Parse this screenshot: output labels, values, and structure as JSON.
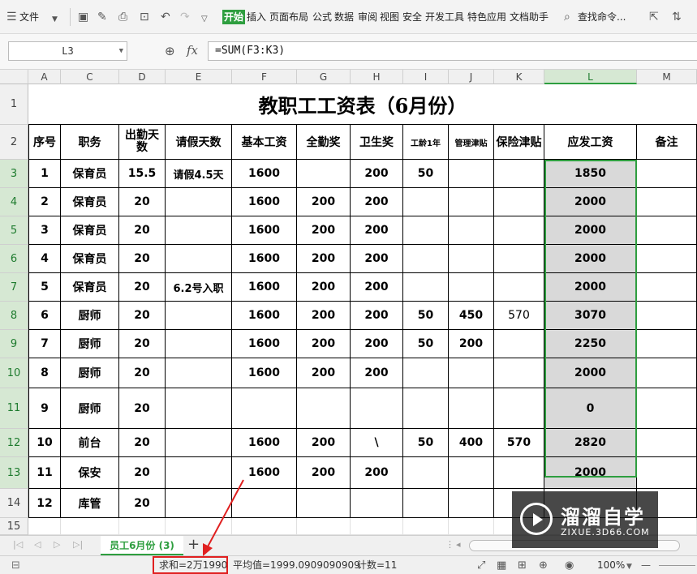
{
  "menubar": {
    "file_label": "文件",
    "tabs": [
      "开始",
      "插入",
      "页面布局",
      "公式",
      "数据",
      "审阅",
      "视图",
      "安全",
      "开发工具",
      "特色应用",
      "文档助手"
    ],
    "active_tab": "开始",
    "search_label": "查找命令..."
  },
  "formula": {
    "cell_ref": "L3",
    "fx_label": "fx",
    "formula_text": "=SUM(F3:K3)"
  },
  "columns": [
    "A",
    "C",
    "D",
    "E",
    "F",
    "G",
    "H",
    "I",
    "J",
    "K",
    "L",
    "M"
  ],
  "rows": [
    "1",
    "2",
    "3",
    "4",
    "5",
    "6",
    "7",
    "8",
    "9",
    "10",
    "11",
    "12",
    "13",
    "14",
    "15"
  ],
  "title": "教职工工资表（6月份）",
  "headers": [
    "序号",
    "职务",
    "出勤天数",
    "请假天数",
    "基本工资",
    "全勤奖",
    "卫生奖",
    "工龄1年",
    "管理津贴",
    "保险津贴",
    "应发工资",
    "备注"
  ],
  "table": [
    [
      "1",
      "保育员",
      "15.5",
      "请假4.5天",
      "1600",
      "",
      "200",
      "50",
      "",
      "",
      "1850",
      ""
    ],
    [
      "2",
      "保育员",
      "20",
      "",
      "1600",
      "200",
      "200",
      "",
      "",
      "",
      "2000",
      ""
    ],
    [
      "3",
      "保育员",
      "20",
      "",
      "1600",
      "200",
      "200",
      "",
      "",
      "",
      "2000",
      ""
    ],
    [
      "4",
      "保育员",
      "20",
      "",
      "1600",
      "200",
      "200",
      "",
      "",
      "",
      "2000",
      ""
    ],
    [
      "5",
      "保育员",
      "20",
      "6.2号入职",
      "1600",
      "200",
      "200",
      "",
      "",
      "",
      "2000",
      ""
    ],
    [
      "6",
      "厨师",
      "20",
      "",
      "1600",
      "200",
      "200",
      "50",
      "450",
      "570",
      "3070",
      ""
    ],
    [
      "7",
      "厨师",
      "20",
      "",
      "1600",
      "200",
      "200",
      "50",
      "200",
      "",
      "2250",
      ""
    ],
    [
      "8",
      "厨师",
      "20",
      "",
      "1600",
      "200",
      "200",
      "",
      "",
      "",
      "2000",
      ""
    ],
    [
      "9",
      "厨师",
      "20",
      "",
      "",
      "",
      "",
      "",
      "",
      "",
      "0",
      ""
    ],
    [
      "10",
      "前台",
      "20",
      "",
      "1600",
      "200",
      "\\",
      "50",
      "400",
      "570",
      "2820",
      ""
    ],
    [
      "11",
      "保安",
      "20",
      "",
      "1600",
      "200",
      "200",
      "",
      "",
      "",
      "2000",
      ""
    ],
    [
      "12",
      "库管",
      "20",
      "",
      "",
      "",
      "",
      "",
      "",
      "",
      "",
      ""
    ]
  ],
  "sheet_tab": "员工6月份 (3)",
  "status": {
    "sum": "求和=2万1990",
    "avg": "平均值=1999.0909090909",
    "count": "计数=11",
    "zoom": "100%"
  },
  "watermark": {
    "name": "溜溜自学",
    "url": "ZIXUE.3D66.COM"
  },
  "colors": {
    "accent": "#2e9e3f",
    "highlight": "#e02020"
  }
}
